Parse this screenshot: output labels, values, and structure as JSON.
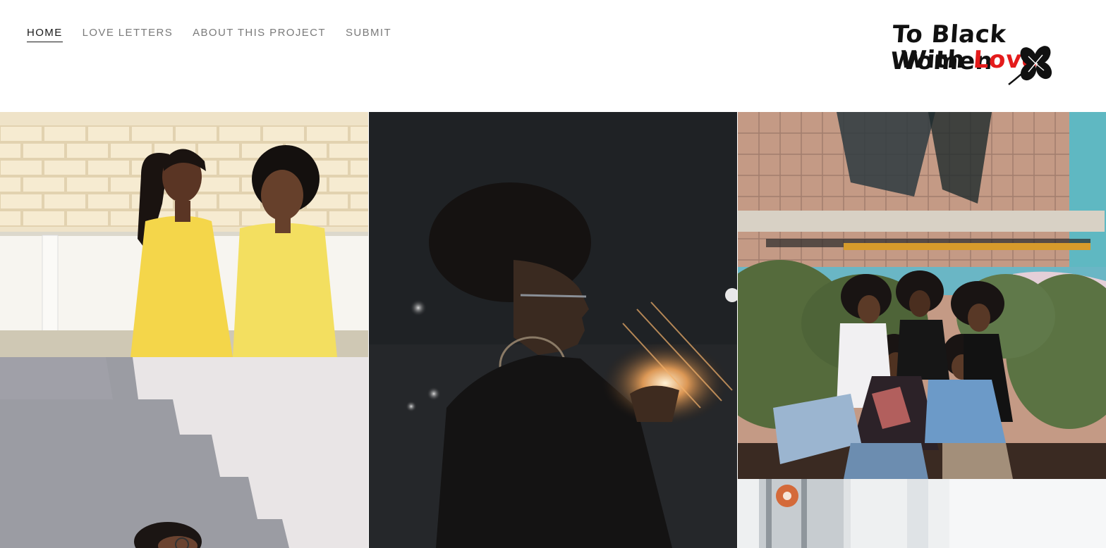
{
  "nav": {
    "items": [
      {
        "label": "HOME",
        "active": true
      },
      {
        "label": "LOVE LETTERS",
        "active": false
      },
      {
        "label": "ABOUT THIS PROJECT",
        "active": false
      },
      {
        "label": "SUBMIT",
        "active": false
      }
    ]
  },
  "logo": {
    "line1": "To Black Women",
    "line2_prefix": "With ",
    "line2_accent": "Love",
    "accent_color": "#e41b1b",
    "icon": "leaf-clover-icon"
  },
  "gallery": {
    "tiles": [
      {
        "subject": "two-girls-yellow-dresses-photo"
      },
      {
        "subject": "woman-staircase-shadow-photo"
      },
      {
        "subject": "woman-glowing-lights-night-photo"
      },
      {
        "subject": "group-of-women-mural-photo"
      },
      {
        "subject": "building-window-photo"
      }
    ]
  }
}
